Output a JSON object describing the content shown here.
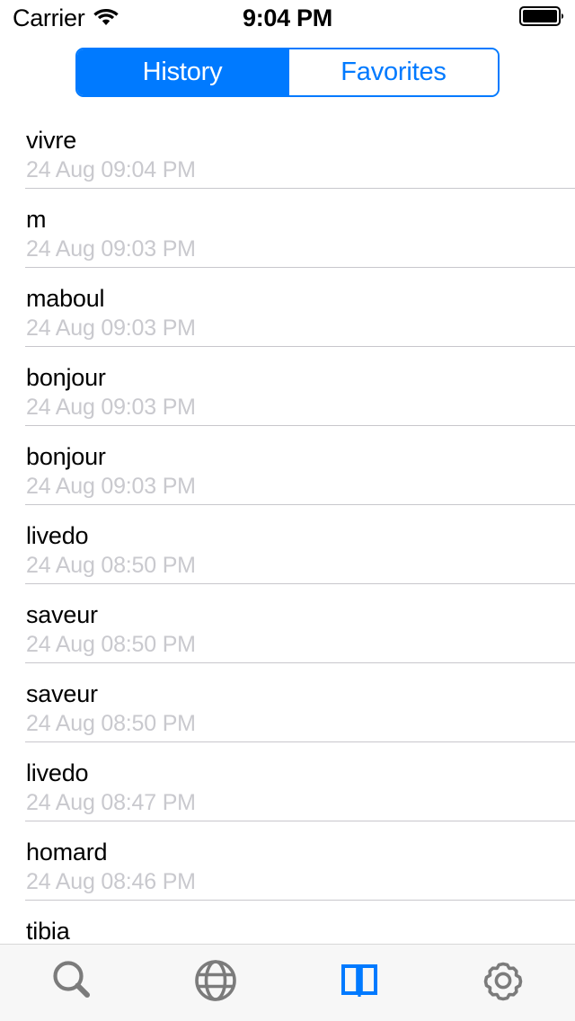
{
  "status_bar": {
    "carrier": "Carrier",
    "wifi_icon": "wifi-icon",
    "time": "9:04 PM",
    "battery_icon": "battery-full-icon"
  },
  "segmented_control": {
    "selected_index": 0,
    "accent_color": "#007AFF",
    "segments": [
      {
        "label": "History",
        "selected": true
      },
      {
        "label": "Favorites",
        "selected": false
      }
    ]
  },
  "history_list": {
    "rows": [
      {
        "term": "vivre",
        "date": "24 Aug 09:04 PM"
      },
      {
        "term": "m",
        "date": "24 Aug 09:03 PM"
      },
      {
        "term": "maboul",
        "date": "24 Aug 09:03 PM"
      },
      {
        "term": "bonjour",
        "date": "24 Aug 09:03 PM"
      },
      {
        "term": "bonjour",
        "date": "24 Aug 09:03 PM"
      },
      {
        "term": "livedo",
        "date": "24 Aug 08:50 PM"
      },
      {
        "term": "saveur",
        "date": "24 Aug 08:50 PM"
      },
      {
        "term": "saveur",
        "date": "24 Aug 08:50 PM"
      },
      {
        "term": "livedo",
        "date": "24 Aug 08:47 PM"
      },
      {
        "term": "homard",
        "date": "24 Aug 08:46 PM"
      },
      {
        "term": "tibia",
        "date": ""
      }
    ]
  },
  "tab_bar": {
    "selected_index": 2,
    "selected_color": "#007AFF",
    "inactive_color": "#7b7b7b",
    "items": [
      {
        "icon": "search-icon",
        "selected": false
      },
      {
        "icon": "globe-icon",
        "selected": false
      },
      {
        "icon": "book-icon",
        "selected": true
      },
      {
        "icon": "gear-icon",
        "selected": false
      }
    ]
  }
}
